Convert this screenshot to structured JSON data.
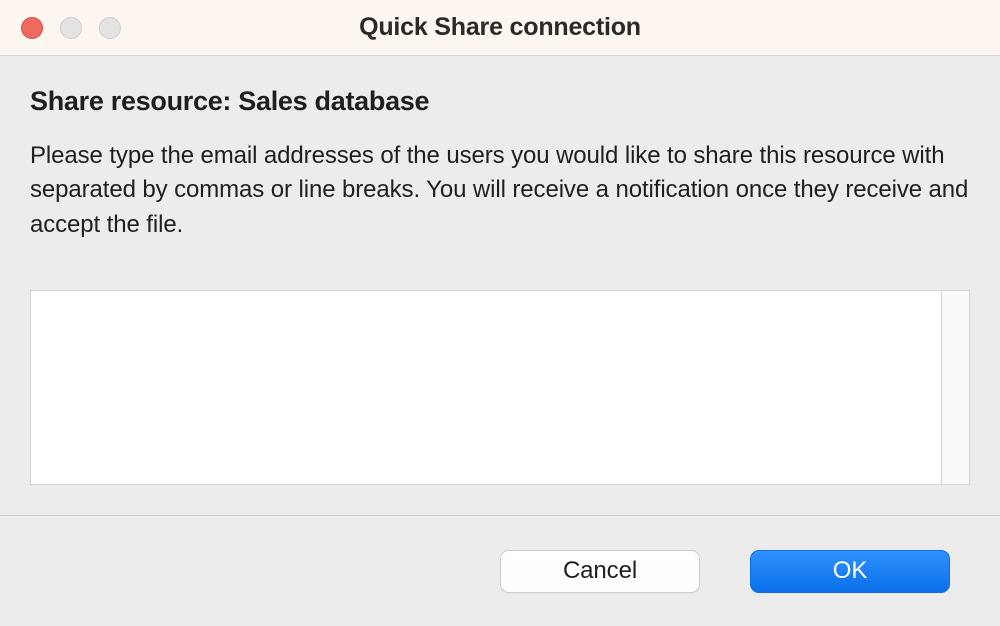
{
  "window": {
    "title": "Quick Share connection"
  },
  "content": {
    "heading": "Share resource: Sales database",
    "description": "Please type the email addresses of the users you would like to share this resource with separated by commas or line breaks. You will receive a notification once they receive and accept the file.",
    "textarea_value": ""
  },
  "buttons": {
    "cancel": "Cancel",
    "ok": "OK"
  }
}
